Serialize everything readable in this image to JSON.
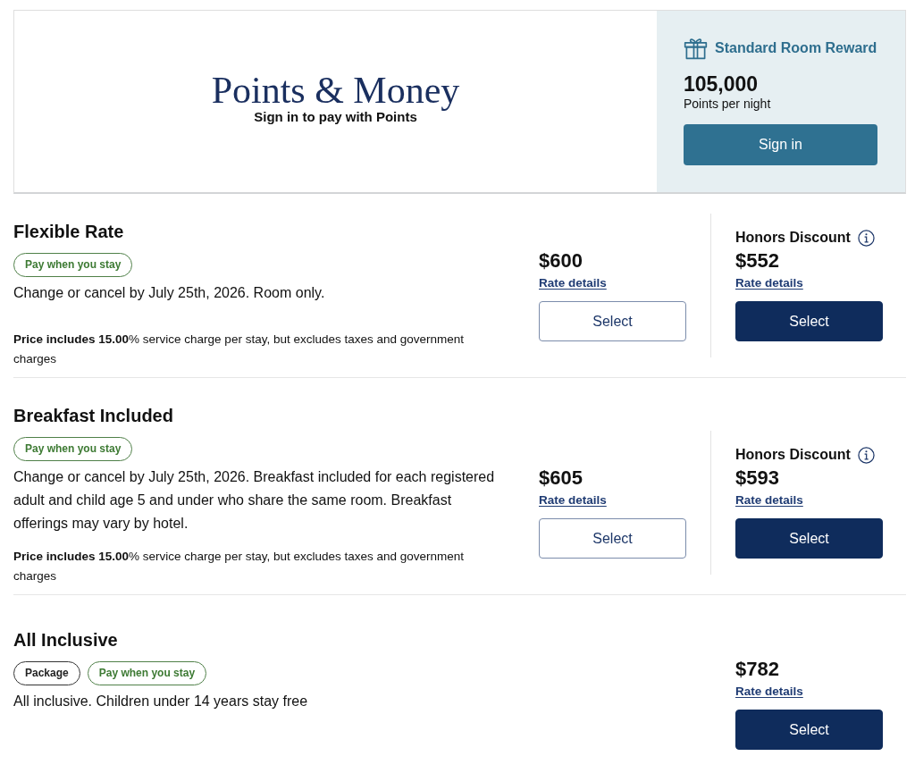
{
  "points_banner": {
    "title": "Points & Money",
    "subtitle": "Sign in to pay with Points",
    "reward": {
      "label": "Standard Room Reward",
      "points": "105,000",
      "caption": "Points per night",
      "button": "Sign in"
    }
  },
  "rates": [
    {
      "title": "Flexible Rate",
      "tags": [
        {
          "label": "Pay when you stay",
          "kind": "payment"
        }
      ],
      "description": "Change or cancel by July 25th, 2026. Room only.",
      "note": "**Price includes 15.00**% service charge per stay, but excludes taxes and government charges",
      "options": [
        {
          "kind": "standard",
          "price": "$600",
          "link": "Rate details",
          "button": "Select"
        },
        {
          "kind": "discount",
          "heading": "Honors Discount",
          "price": "$552",
          "link": "Rate details",
          "button": "Select"
        }
      ]
    },
    {
      "title": "Breakfast Included",
      "tags": [
        {
          "label": "Pay when you stay",
          "kind": "payment"
        }
      ],
      "description": "Change or cancel by July 25th, 2026. Breakfast included for each registered adult and child age 5 and under who share the same room. Breakfast offerings may vary by hotel.",
      "note": "**Price includes 15.00**% service charge per stay, but excludes taxes and government charges",
      "options": [
        {
          "kind": "standard",
          "price": "$605",
          "link": "Rate details",
          "button": "Select"
        },
        {
          "kind": "discount",
          "heading": "Honors Discount",
          "price": "$593",
          "link": "Rate details",
          "button": "Select"
        }
      ]
    },
    {
      "title": "All Inclusive",
      "tags": [
        {
          "label": "Package",
          "kind": "package"
        },
        {
          "label": "Pay when you stay",
          "kind": "payment"
        }
      ],
      "description": "All inclusive. Children under 14 years stay free",
      "options": [
        {
          "kind": "package",
          "price": "$782",
          "link": "Rate details",
          "button": "Select"
        }
      ]
    }
  ]
}
